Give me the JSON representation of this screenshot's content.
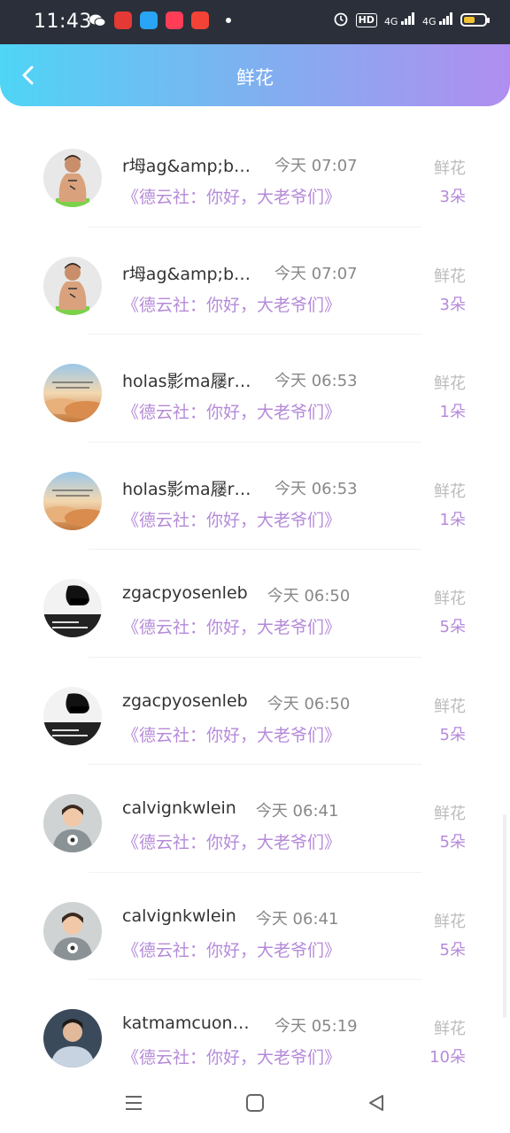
{
  "status_bar": {
    "time": "11:43",
    "hd_label": "HD",
    "net1": "4G",
    "net2": "4G",
    "battery_level": 0.55,
    "colors": {
      "battery": "#f3c232",
      "background": "#2b2f3a"
    }
  },
  "header": {
    "title": "鲜花",
    "back_icon": "chevron-left-icon",
    "gradient": [
      "#4fd5f6",
      "#b08ef0"
    ]
  },
  "accent_color": "#b58ad9",
  "rows": [
    {
      "name": "r坶ag&amp;bo...",
      "time": "今天 07:07",
      "subtitle": "《德云社：你好，大老爷们》",
      "label": "鲜花",
      "count": "3朵",
      "avatar": "avatar-shirtless-man"
    },
    {
      "name": "r坶ag&amp;bo...",
      "time": "今天 07:07",
      "subtitle": "《德云社：你好，大老爷们》",
      "label": "鲜花",
      "count": "3朵",
      "avatar": "avatar-shirtless-man"
    },
    {
      "name": "holas影ma屦rt...",
      "time": "今天 06:53",
      "subtitle": "《德云社：你好，大老爷们》",
      "label": "鲜花",
      "count": "1朵",
      "avatar": "avatar-sunset-clouds"
    },
    {
      "name": "holas影ma屦rt...",
      "time": "今天 06:53",
      "subtitle": "《德云社：你好，大老爷们》",
      "label": "鲜花",
      "count": "1朵",
      "avatar": "avatar-sunset-clouds"
    },
    {
      "name": "zgacpyosenleb",
      "time": "今天 06:50",
      "subtitle": "《德云社：你好，大老爷们》",
      "label": "鲜花",
      "count": "5朵",
      "avatar": "avatar-bw-portrait"
    },
    {
      "name": "zgacpyosenleb",
      "time": "今天 06:50",
      "subtitle": "《德云社：你好，大老爷们》",
      "label": "鲜花",
      "count": "5朵",
      "avatar": "avatar-bw-portrait"
    },
    {
      "name": "calvignkwlein",
      "time": "今天 06:41",
      "subtitle": "《德云社：你好，大老爷们》",
      "label": "鲜花",
      "count": "5朵",
      "avatar": "avatar-child"
    },
    {
      "name": "calvignkwlein",
      "time": "今天 06:41",
      "subtitle": "《德云社：你好，大老爷们》",
      "label": "鲜花",
      "count": "5朵",
      "avatar": "avatar-child"
    },
    {
      "name": "katmamcuonsi...",
      "time": "今天 05:19",
      "subtitle": "《德云社：你好，大老爷们》",
      "label": "鲜花",
      "count": "10朵",
      "avatar": "avatar-young-man"
    }
  ],
  "nav_bar": {
    "menu_icon": "menu-icon",
    "home_icon": "home-square-icon",
    "back_icon": "back-triangle-icon"
  }
}
